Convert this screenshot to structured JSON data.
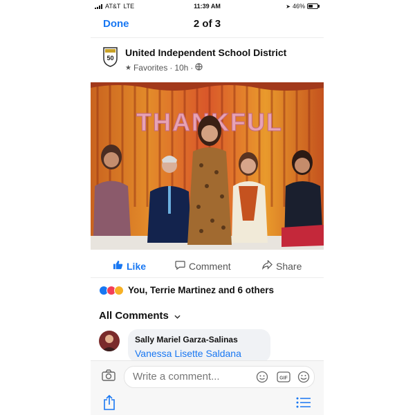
{
  "status_bar": {
    "carrier": "AT&T",
    "network": "LTE",
    "time": "11:39 AM",
    "battery": "46%",
    "battery_level": 0.46
  },
  "nav": {
    "done_label": "Done",
    "counter": "2 of 3"
  },
  "post": {
    "author": "United Independent School District",
    "logo_text": "50",
    "audience_label": "Favorites",
    "time_ago": "10h",
    "photo_banner_text": "THANKFUL",
    "icons": {
      "star": "star-icon",
      "globe": "globe-icon",
      "logo": "district-logo"
    }
  },
  "actions": {
    "like_label": "Like",
    "comment_label": "Comment",
    "share_label": "Share",
    "icons": {
      "like": "thumbs-up-icon",
      "comment": "comment-bubble-icon",
      "share": "share-arrow-icon"
    }
  },
  "reactions": {
    "summary": "You, Terrie Martinez and 6 others",
    "types": [
      "like",
      "love",
      "care"
    ],
    "colors": {
      "like": "#1877f2",
      "love": "#f33e58",
      "care": "#f7b125"
    }
  },
  "comments": {
    "filter_label": "All Comments",
    "items": [
      {
        "author": "Sally Mariel Garza-Salinas",
        "text": "Vanessa Lisette Saldana"
      }
    ]
  },
  "composer": {
    "placeholder": "Write a comment...",
    "icons": [
      "camera-icon",
      "sticker-icon",
      "gif-icon",
      "emoji-icon"
    ]
  },
  "toolbar": {
    "icons": [
      "share-sheet-icon",
      "list-icon"
    ]
  },
  "colors": {
    "accent": "#1877f2"
  }
}
